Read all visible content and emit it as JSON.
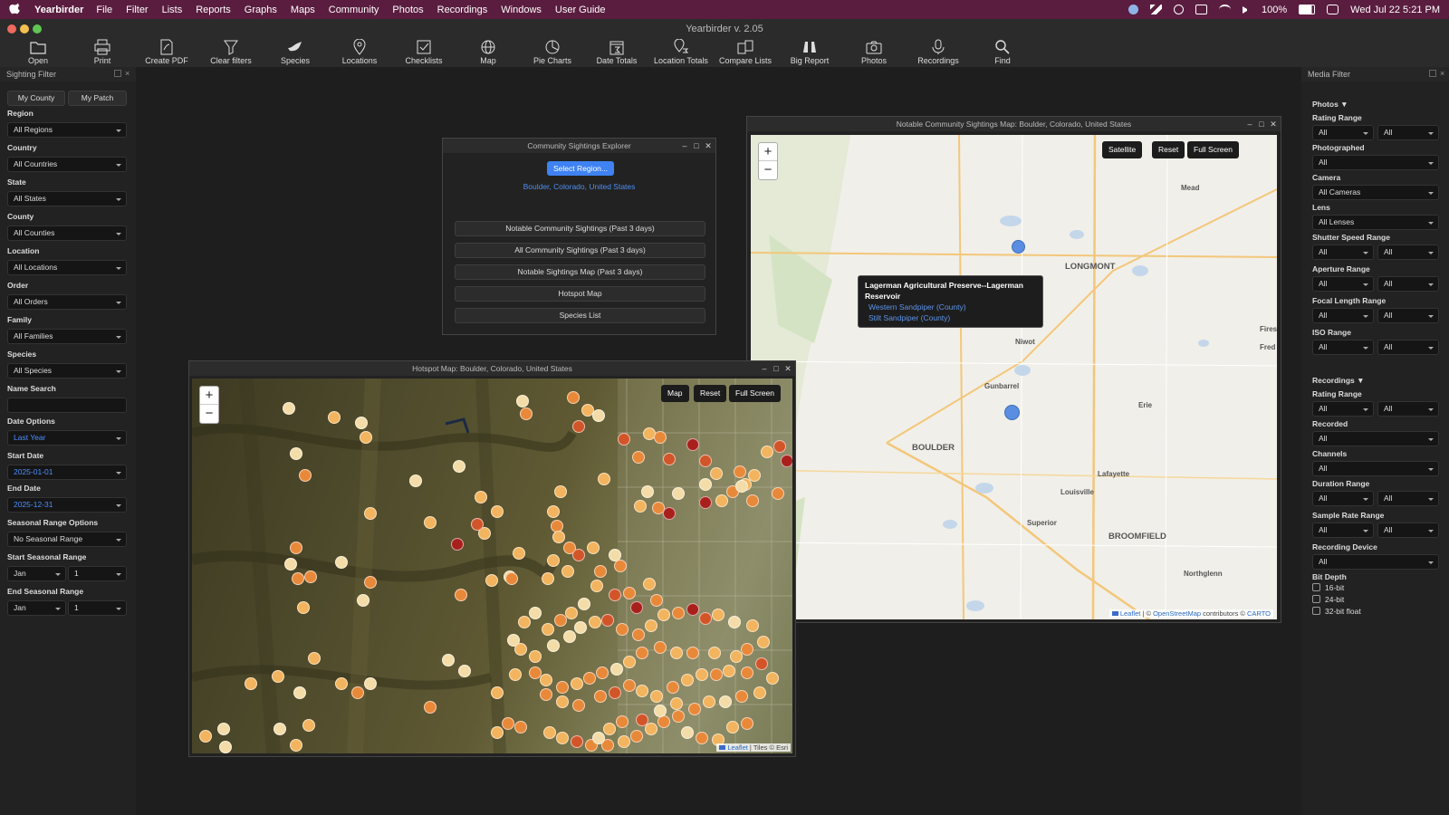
{
  "menubar": {
    "app_name": "Yearbirder",
    "items": [
      "File",
      "Filter",
      "Lists",
      "Reports",
      "Graphs",
      "Maps",
      "Community",
      "Photos",
      "Recordings",
      "Windows",
      "User Guide"
    ],
    "battery": "100%",
    "clock": "Wed Jul 22  5:21 PM"
  },
  "window": {
    "title": "Yearbirder v. 2.05"
  },
  "toolbar": {
    "items": [
      "Open",
      "Print",
      "Create PDF",
      "Clear filters",
      "Species",
      "Locations",
      "Checklists",
      "Map",
      "Pie Charts",
      "Date Totals",
      "Location Totals",
      "Compare Lists",
      "Big Report",
      "Photos",
      "Recordings",
      "Find"
    ]
  },
  "sighting_filter": {
    "title": "Sighting Filter",
    "my_county": "My County",
    "my_patch": "My Patch",
    "region_label": "Region",
    "region_value": "All Regions",
    "country_label": "Country",
    "country_value": "All Countries",
    "state_label": "State",
    "state_value": "All States",
    "county_label": "County",
    "county_value": "All Counties",
    "location_label": "Location",
    "location_value": "All Locations",
    "order_label": "Order",
    "order_value": "All Orders",
    "family_label": "Family",
    "family_value": "All Families",
    "species_label": "Species",
    "species_value": "All Species",
    "name_search_label": "Name Search",
    "date_options_label": "Date Options",
    "date_options_value": "Last Year",
    "start_date_label": "Start Date",
    "start_date_value": "2025-01-01",
    "end_date_label": "End Date",
    "end_date_value": "2025-12-31",
    "seasonal_label": "Seasonal Range Options",
    "seasonal_value": "No Seasonal Range",
    "start_seasonal_label": "Start Seasonal Range",
    "start_seasonal_month": "Jan",
    "start_seasonal_day": "1",
    "end_seasonal_label": "End Seasonal Range",
    "end_seasonal_month": "Jan",
    "end_seasonal_day": "1"
  },
  "media_filter": {
    "title": "Media Filter",
    "photos_head": "Photos ▼",
    "rating_range": "Rating Range",
    "all": "All",
    "photographed": "Photographed",
    "camera": "Camera",
    "camera_value": "All Cameras",
    "lens": "Lens",
    "lens_value": "All Lenses",
    "shutter": "Shutter Speed Range",
    "aperture": "Aperture Range",
    "focal": "Focal Length Range",
    "iso": "ISO Range",
    "recordings_head": "Recordings ▼",
    "recorded": "Recorded",
    "channels": "Channels",
    "duration": "Duration Range",
    "sample_rate": "Sample Rate Range",
    "device": "Recording Device",
    "bit_depth": "Bit Depth",
    "bit16": "16-bit",
    "bit24": "24-bit",
    "bit32": "32-bit float"
  },
  "explorer": {
    "title": "Community Sightings Explorer",
    "select_region": "Select Region...",
    "region": "Boulder, Colorado, United States",
    "buttons": [
      "Notable Community Sightings (Past 3 days)",
      "All Community Sightings (Past 3 days)",
      "Notable Sightings Map (Past 3 days)",
      "Hotspot Map",
      "Species List"
    ]
  },
  "notable_map": {
    "title": "Notable Community Sightings Map: Boulder, Colorado, United States",
    "satellite": "Satellite",
    "reset": "Reset",
    "full_screen": "Full Screen",
    "towns": [
      "Mead",
      "LONGMONT",
      "Niwot",
      "Gunbarrel",
      "Erie",
      "BOULDER",
      "Lafayette",
      "Louisville",
      "Superior",
      "BROOMFIELD",
      "Northglenn",
      "Firest",
      "Fred"
    ],
    "popup_title": "Lagerman Agricultural Preserve--Lagerman Reservoir",
    "popup_species": [
      "Western Sandpiper (County)",
      "Stilt Sandpiper (County)"
    ],
    "attribution": {
      "leaflet": "Leaflet",
      "sep": " | © ",
      "osm": "OpenStreetMap",
      "contrib": " contributors © ",
      "carto": "CARTO"
    }
  },
  "hotspot_map": {
    "title": "Hotspot Map: Boulder, Colorado, United States",
    "map": "Map",
    "reset": "Reset",
    "full_screen": "Full Screen",
    "attribution": {
      "leaflet": "Leaflet",
      "rest": " | Tiles © Esri"
    },
    "colors": {
      "pale": "#f3dca8",
      "light": "#f2b45e",
      "orange": "#e8893a",
      "dark": "#d2552a",
      "red": "#a8201c"
    }
  }
}
